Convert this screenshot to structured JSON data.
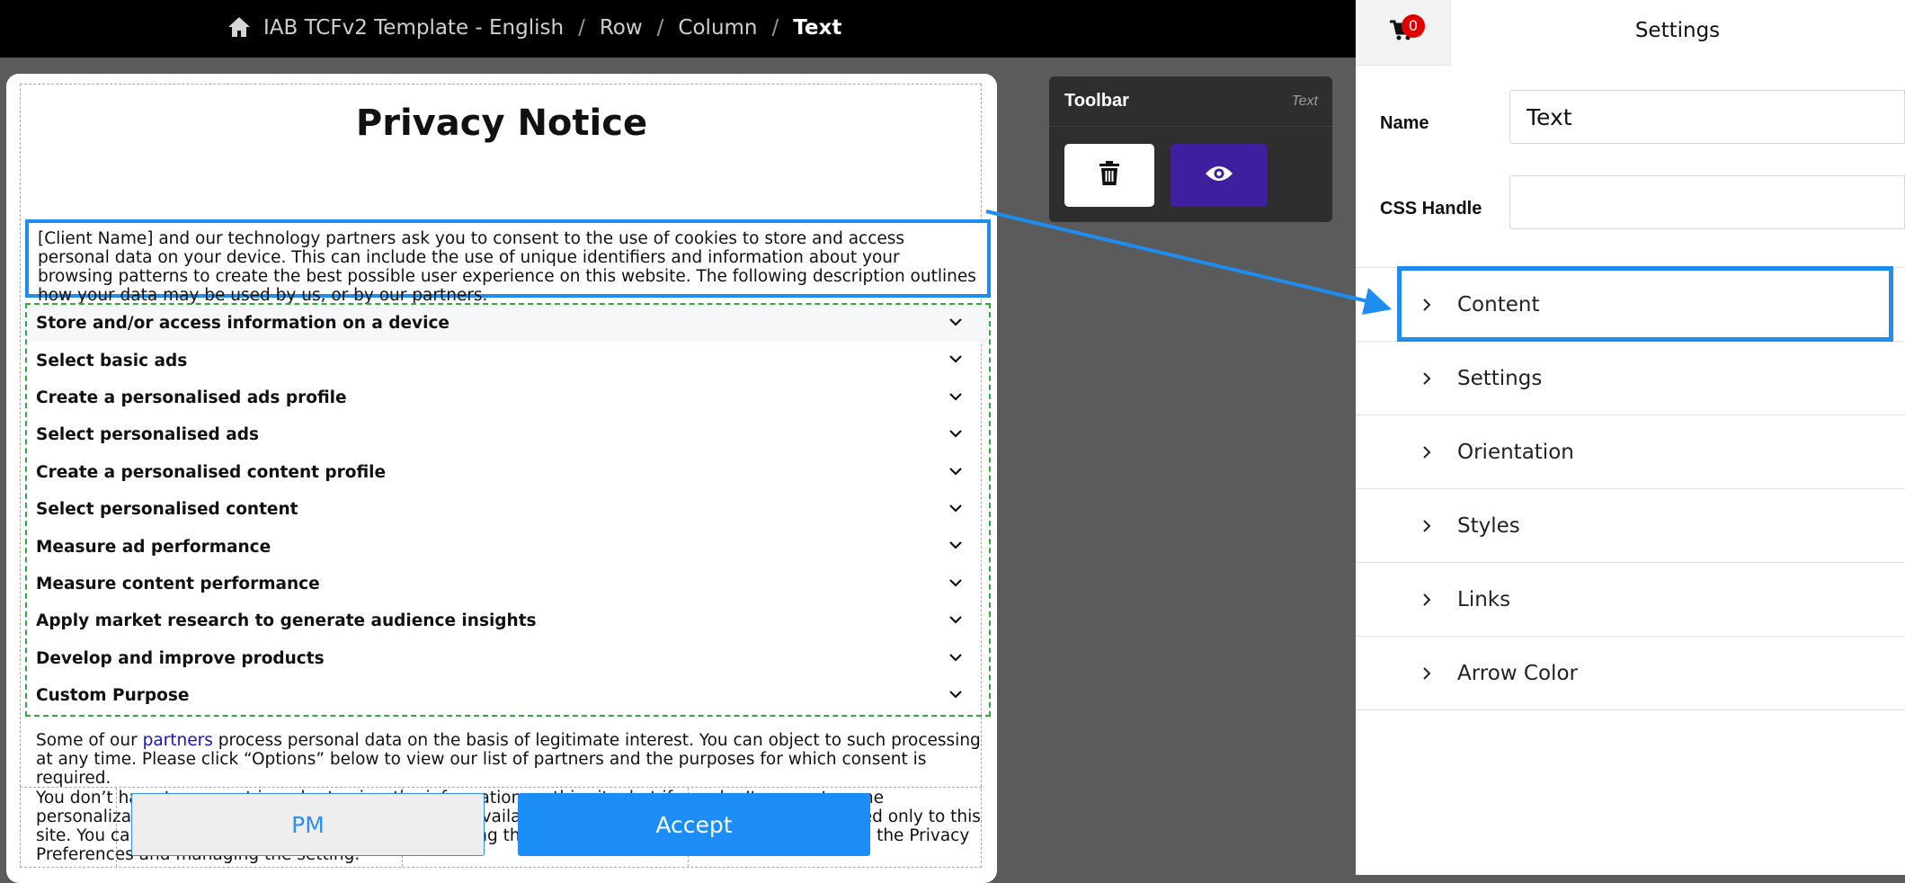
{
  "breadcrumb": {
    "template": "IAB TCFv2 Template - English",
    "row": "Row",
    "column": "Column",
    "current": "Text",
    "separator": "/"
  },
  "message": {
    "title": "Privacy Notice",
    "intro": "[Client Name] and our technology partners ask you to consent to the use of cookies to store and access personal data on your device. This can include the use of unique identifiers and information about your browsing patterns to create the best possible user experience on this website. The following description outlines how your data may be used by us, or by our partners.",
    "purposes": [
      "Store and/or access information on a device",
      "Select basic ads",
      "Create a personalised ads profile",
      "Select personalised ads",
      "Create a personalised content profile",
      "Select personalised content",
      "Measure ad performance",
      "Measure content performance",
      "Apply market research to generate audience insights",
      "Develop and improve products",
      "Custom Purpose"
    ],
    "legit_before": "Some of our ",
    "legit_link": "partners",
    "legit_after": " process personal data on the basis of legitimate interest. You can object to such processing at any time. Please click “Options” below to view our list of partners and the purposes for which consent is required.",
    "optional": "You don’t have to consent in order to view the information on this site, but if you don’t consent, some personalization of content and advertising won’t be available. Your choices on this site will be applied only to this site. You can change your settings at any time by using the link at the bottom of the page to reopen the Privacy Preferences and managing the setting.",
    "pm_button": "PM",
    "accept_button": "Accept"
  },
  "toolbar": {
    "title": "Toolbar",
    "type": "Text",
    "delete_icon": "trash-icon",
    "preview_icon": "eye-icon"
  },
  "panel": {
    "title": "Settings",
    "cart_count": "0",
    "name_label": "Name",
    "name_value": "Text",
    "css_label": "CSS Handle",
    "css_value": "",
    "sections": [
      "Content",
      "Settings",
      "Orientation",
      "Styles",
      "Links",
      "Arrow Color"
    ]
  },
  "colors": {
    "highlight": "#1d8ef0",
    "accept": "#1c8df6",
    "preview": "#3d1fa0",
    "purposes_border": "#2eaa3e",
    "badge": "#e00000"
  }
}
